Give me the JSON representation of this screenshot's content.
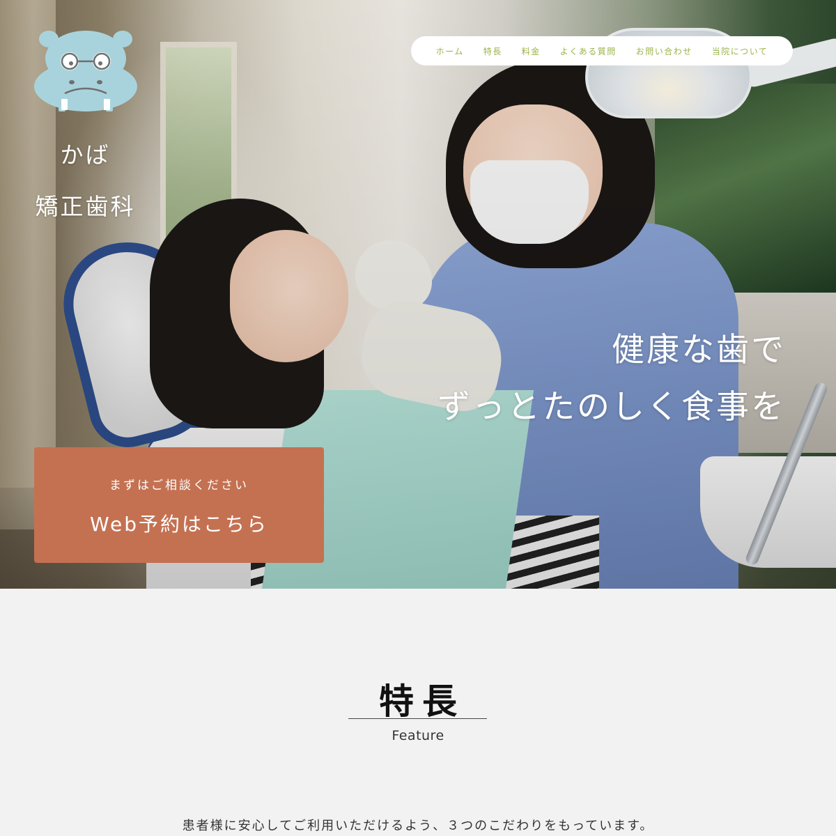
{
  "site": {
    "logo_line1": "かば",
    "logo_line2": "矯正歯科",
    "logo_color": "#a9d3dc"
  },
  "nav": {
    "items": [
      {
        "label": "ホーム"
      },
      {
        "label": "特長"
      },
      {
        "label": "料金"
      },
      {
        "label": "よくある質問"
      },
      {
        "label": "お問い合わせ"
      },
      {
        "label": "当院について"
      }
    ],
    "text_color": "#9bb34a"
  },
  "hero": {
    "headline_line1": "健康な歯で",
    "headline_line2": "ずっとたのしく食事を"
  },
  "cta": {
    "sub_label": "まずはご相談ください",
    "main_label": "Web予約はこちら",
    "color": "#c47152"
  },
  "feature": {
    "title": "特長",
    "subtitle": "Feature",
    "description": "患者様に安心してご利用いただけるよう、３つのこだわりをもっています。"
  }
}
